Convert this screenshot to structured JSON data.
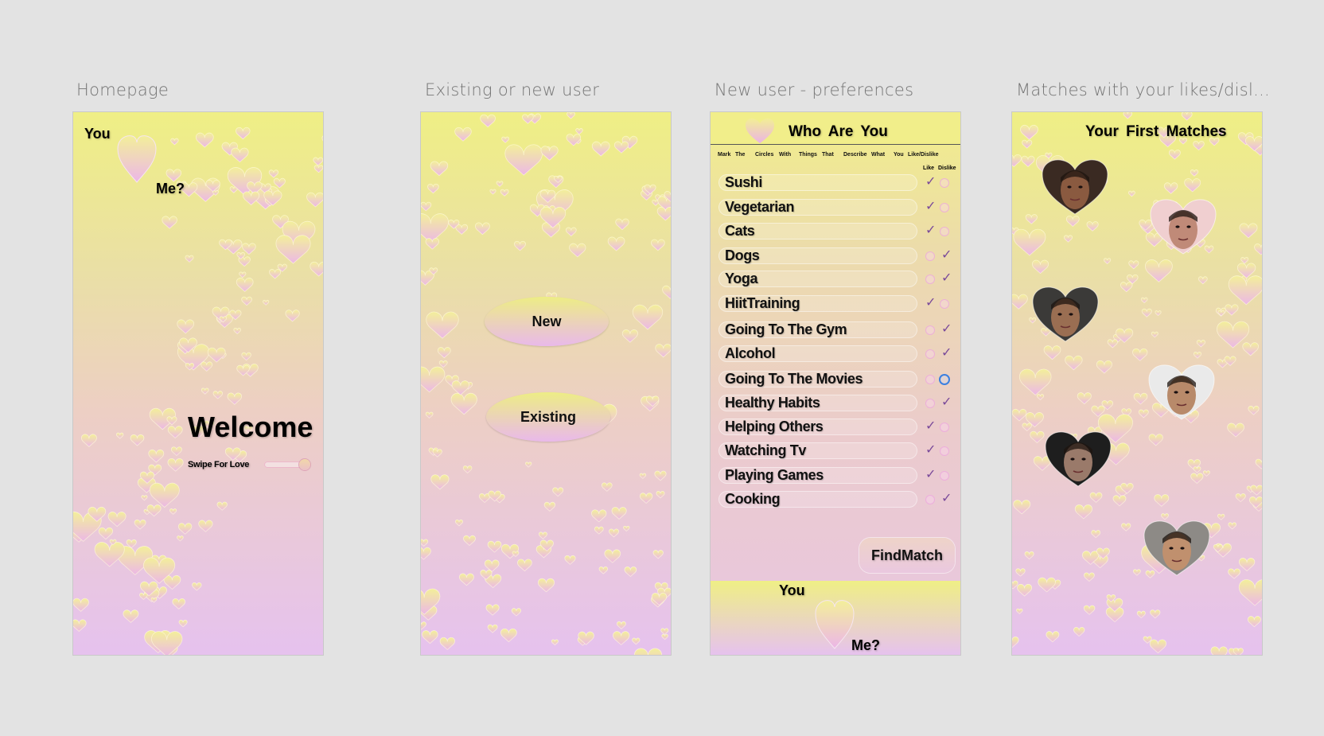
{
  "frames": {
    "homepage": {
      "label": "Homepage",
      "you": "You",
      "me": "Me?",
      "welcome": "Welcome",
      "swipe_label": "Swipe For Love"
    },
    "existing_or_new": {
      "label": "Existing or new user",
      "new_button": "New",
      "existing_button": "Existing"
    },
    "preferences": {
      "label": "New user - preferences",
      "title": "Who Are You",
      "instruction_words": [
        "Mark",
        "The",
        "Circles",
        "With",
        "Things",
        "That",
        "Describe",
        "What",
        "You",
        "Like/Dislike"
      ],
      "like_header": "Like",
      "dislike_header": "Dislike",
      "items": [
        {
          "label": "Sushi",
          "choice": "like"
        },
        {
          "label": "Vegetarian",
          "choice": "like"
        },
        {
          "label": "Cats",
          "choice": "like"
        },
        {
          "label": "Dogs",
          "choice": "dislike"
        },
        {
          "label": "Yoga",
          "choice": "dislike"
        },
        {
          "label": "HiitTraining",
          "choice": "like"
        },
        {
          "label": "Going To The Gym",
          "choice": "dislike"
        },
        {
          "label": "Alcohol",
          "choice": "dislike"
        },
        {
          "label": "Going To The Movies",
          "choice": "dislike-selected"
        },
        {
          "label": "Healthy Habits",
          "choice": "dislike"
        },
        {
          "label": "Helping Others",
          "choice": "like"
        },
        {
          "label": "Watching Tv",
          "choice": "like"
        },
        {
          "label": "Playing Games",
          "choice": "like"
        },
        {
          "label": "Cooking",
          "choice": "dislike"
        }
      ],
      "find_button": "FindMatch",
      "footer_you": "You",
      "footer_me": "Me?"
    },
    "matches": {
      "label": "Matches with your likes/disl...",
      "title": "Your First Matches",
      "profiles": [
        "match-1",
        "match-2",
        "match-3",
        "match-4",
        "match-5",
        "match-6"
      ]
    }
  },
  "colors": {
    "canvas": "#e3e3e3",
    "gradient_top": "#efef85",
    "gradient_bottom": "#e6c2ee",
    "heart_yellow": "#f3ef9a",
    "heart_pink": "#ecb8e6",
    "selected_ring": "#3b7fe0"
  }
}
